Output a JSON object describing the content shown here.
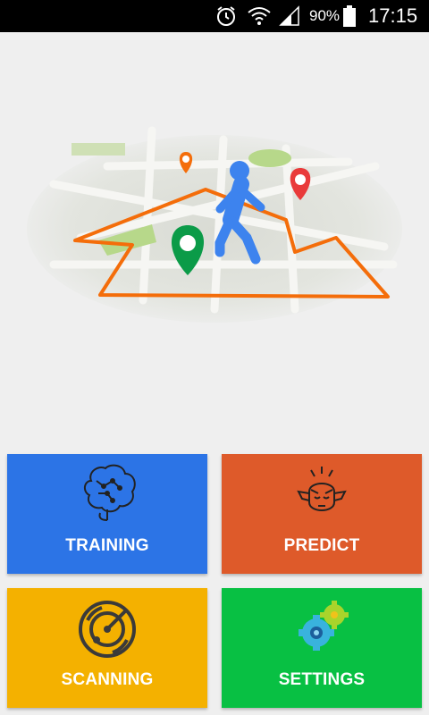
{
  "status_bar": {
    "battery_text": "90%",
    "time": "17:15",
    "icons": [
      "alarm-clock-icon",
      "wifi-icon",
      "signal-icon",
      "battery-icon"
    ]
  },
  "hero": {
    "illustration": "map-with-walking-person-and-location-pins"
  },
  "tiles": [
    {
      "label": "TRAINING",
      "color": "#2c74e6",
      "icon": "brain-circuit-icon"
    },
    {
      "label": "PREDICT",
      "color": "#de5a2a",
      "icon": "thinking-head-icon"
    },
    {
      "label": "SCANNING",
      "color": "#f4b100",
      "icon": "radar-icon"
    },
    {
      "label": "SETTINGS",
      "color": "#08c043",
      "icon": "gears-icon"
    }
  ]
}
